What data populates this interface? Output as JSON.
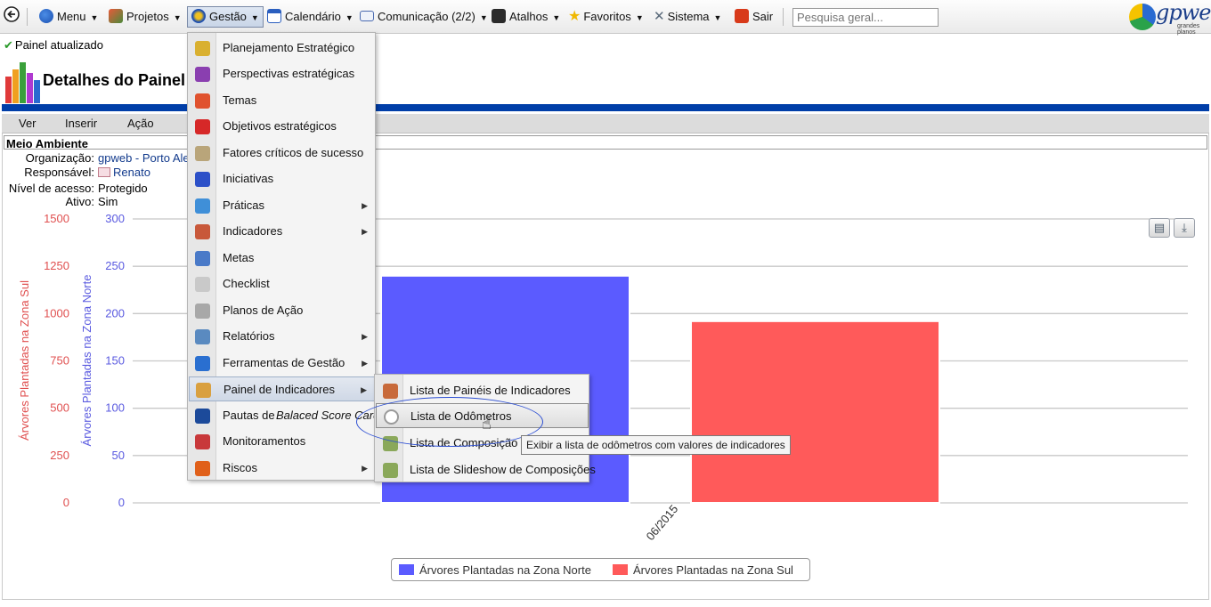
{
  "topbar": {
    "menu_label": "Menu",
    "projetos_label": "Projetos",
    "gestao_label": "Gestão",
    "calendario_label": "Calendário",
    "comunicacao_label": "Comunicação (2/2)",
    "atalhos_label": "Atalhos",
    "favoritos_label": "Favoritos",
    "sistema_label": "Sistema",
    "sair_label": "Sair",
    "search_placeholder": "Pesquisa geral...",
    "logo_text": "gpweb",
    "logo_sub": "grandes planos"
  },
  "status": {
    "text": "Painel atualizado"
  },
  "page": {
    "title": "Detalhes do Painel"
  },
  "actionbar": {
    "ver": "Ver",
    "inserir": "Inserir",
    "acao": "Ação"
  },
  "info": {
    "title": "Meio Ambiente",
    "org_label": "Organização:",
    "org_value": "gpweb - Porto Alegre",
    "resp_label": "Responsável:",
    "resp_value": "Renato",
    "access_label": "Nível de acesso:",
    "access_value": "Protegido",
    "active_label": "Ativo:",
    "active_value": "Sim"
  },
  "gestao_menu": [
    {
      "label": "Planejamento Estratégico",
      "icon": "strategic-planning-icon",
      "color": "#d9b030",
      "submenu": false
    },
    {
      "label": "Perspectivas estratégicas",
      "icon": "perspectives-icon",
      "color": "#8a3fb0",
      "submenu": false
    },
    {
      "label": "Temas",
      "icon": "themes-icon",
      "color": "#e0522e",
      "submenu": false
    },
    {
      "label": "Objetivos estratégicos",
      "icon": "target-icon",
      "color": "#d62828",
      "submenu": false
    },
    {
      "label": "Fatores críticos de sucesso",
      "icon": "key-icon",
      "color": "#b9a57a",
      "submenu": false
    },
    {
      "label": "Iniciativas",
      "icon": "initiatives-icon",
      "color": "#2c50c8",
      "submenu": false
    },
    {
      "label": "Práticas",
      "icon": "practices-icon",
      "color": "#3f8fd8",
      "submenu": true
    },
    {
      "label": "Indicadores",
      "icon": "indicators-icon",
      "color": "#c8583a",
      "submenu": true
    },
    {
      "label": "Metas",
      "icon": "goals-icon",
      "color": "#4a7ac8",
      "submenu": false
    },
    {
      "label": "Checklist",
      "icon": "checklist-icon",
      "color": "#c9c9c9",
      "submenu": false
    },
    {
      "label": "Planos de Ação",
      "icon": "action-plans-icon",
      "color": "#a8a8a8",
      "submenu": false
    },
    {
      "label": "Relatórios",
      "icon": "reports-icon",
      "color": "#5a8ac0",
      "submenu": true
    },
    {
      "label": "Ferramentas de Gestão",
      "icon": "tools-icon",
      "color": "#2a6fd0",
      "submenu": true
    },
    {
      "label": "Painel de Indicadores",
      "icon": "dashboard-icon",
      "color": "#d9a040",
      "submenu": true
    },
    {
      "label": "Pautas de ",
      "label_italic": "Balaced Score Card",
      "icon": "bsc-icon",
      "color": "#1c4a9a",
      "submenu": false
    },
    {
      "label": "Monitoramentos",
      "icon": "monitoring-icon",
      "color": "#c8383a",
      "submenu": false
    },
    {
      "label": "Riscos",
      "icon": "risks-icon",
      "color": "#e0601a",
      "submenu": true
    }
  ],
  "sub_menu": [
    {
      "label": "Lista de Painéis de Indicadores",
      "icon": "dashboard-list-icon",
      "color": "#c86a3a"
    },
    {
      "label": "Lista de Odômetros",
      "icon": "odometer-icon",
      "color": "#9a9a9a"
    },
    {
      "label": "Lista de Composição de",
      "icon": "composition-icon",
      "color": "#8aa85a"
    },
    {
      "label": "Lista de Slideshow de Composições",
      "icon": "slideshow-icon",
      "color": "#8aa85a"
    }
  ],
  "tooltip": {
    "text": "Exibir a lista de odômetros com valores de indicadores"
  },
  "chart_data": {
    "type": "bar",
    "categories": [
      "06/2015"
    ],
    "series": [
      {
        "name": "Árvores Plantadas na Zona Norte",
        "values": [
          240
        ],
        "color": "#5b5bff",
        "axis": "right-inner"
      },
      {
        "name": "Árvores Plantadas na Zona Sul",
        "values": [
          960
        ],
        "color": "#ff5a5a",
        "axis": "left-outer"
      }
    ],
    "y_axis_sul": {
      "label": "Árvores Plantadas na Zona Sul",
      "ticks": [
        0,
        250,
        500,
        750,
        1000,
        1250,
        1500
      ],
      "range": [
        0,
        1500
      ],
      "color": "#e05050"
    },
    "y_axis_norte": {
      "label": "Árvores Plantadas na Zona Norte",
      "ticks": [
        0,
        50,
        100,
        150,
        200,
        250,
        300
      ],
      "range": [
        0,
        300
      ],
      "color": "#5a5ae0"
    },
    "grid": true,
    "legend_position": "bottom-center"
  }
}
